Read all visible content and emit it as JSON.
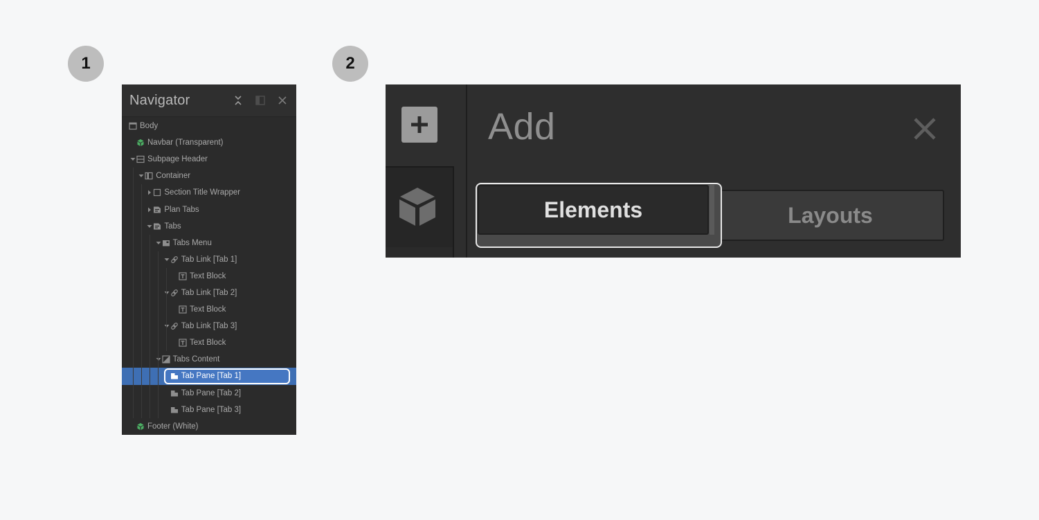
{
  "steps": [
    {
      "number": "1"
    },
    {
      "number": "2"
    }
  ],
  "navigator": {
    "title": "Navigator",
    "header_icons": [
      "collapse-all-icon",
      "dock-panel-icon",
      "close-icon"
    ],
    "tree": [
      {
        "label": "Body",
        "depth": 0,
        "icon": "body-icon",
        "caret": "none"
      },
      {
        "label": "Navbar (Transparent)",
        "depth": 1,
        "icon": "symbol-icon",
        "caret": "none"
      },
      {
        "label": "Subpage Header",
        "depth": 1,
        "icon": "section-icon",
        "caret": "expanded"
      },
      {
        "label": "Container",
        "depth": 2,
        "icon": "container-icon",
        "caret": "expanded"
      },
      {
        "label": "Section Title Wrapper",
        "depth": 3,
        "icon": "div-block-icon",
        "caret": "collapsed"
      },
      {
        "label": "Plan Tabs",
        "depth": 3,
        "icon": "tabs-icon",
        "caret": "collapsed"
      },
      {
        "label": "Tabs",
        "depth": 3,
        "icon": "tabs-icon",
        "caret": "expanded"
      },
      {
        "label": "Tabs Menu",
        "depth": 4,
        "icon": "tabs-menu-icon",
        "caret": "expanded"
      },
      {
        "label": "Tab Link [Tab 1]",
        "depth": 5,
        "icon": "link-icon",
        "caret": "expanded"
      },
      {
        "label": "Text Block",
        "depth": 6,
        "icon": "text-block-icon",
        "caret": "none"
      },
      {
        "label": "Tab Link [Tab 2]",
        "depth": 5,
        "icon": "link-icon",
        "caret": "expanded"
      },
      {
        "label": "Text Block",
        "depth": 6,
        "icon": "text-block-icon",
        "caret": "none"
      },
      {
        "label": "Tab Link [Tab 3]",
        "depth": 5,
        "icon": "link-icon",
        "caret": "expanded"
      },
      {
        "label": "Text Block",
        "depth": 6,
        "icon": "text-block-icon",
        "caret": "none"
      },
      {
        "label": "Tabs Content",
        "depth": 4,
        "icon": "tabs-content-icon",
        "caret": "expanded"
      },
      {
        "label": "Tab Pane [Tab 1]",
        "depth": 5,
        "icon": "tab-pane-icon",
        "caret": "none",
        "selected": true
      },
      {
        "label": "Tab Pane [Tab 2]",
        "depth": 5,
        "icon": "tab-pane-icon",
        "caret": "none"
      },
      {
        "label": "Tab Pane [Tab 3]",
        "depth": 5,
        "icon": "tab-pane-icon",
        "caret": "none"
      },
      {
        "label": "Footer (White)",
        "depth": 1,
        "icon": "symbol-icon",
        "caret": "none"
      }
    ]
  },
  "add_panel": {
    "title": "Add",
    "rail_icons": [
      "plus-icon",
      "cube-icon"
    ],
    "tabs": [
      {
        "label": "Elements",
        "active": true,
        "focused": true
      },
      {
        "label": "Layouts",
        "active": false
      }
    ]
  },
  "colors": {
    "selection": "#3e6fb4",
    "symbol_green": "#4caf64",
    "panel_bg": "#2b2b2b",
    "page_bg": "#f6f7f8"
  }
}
